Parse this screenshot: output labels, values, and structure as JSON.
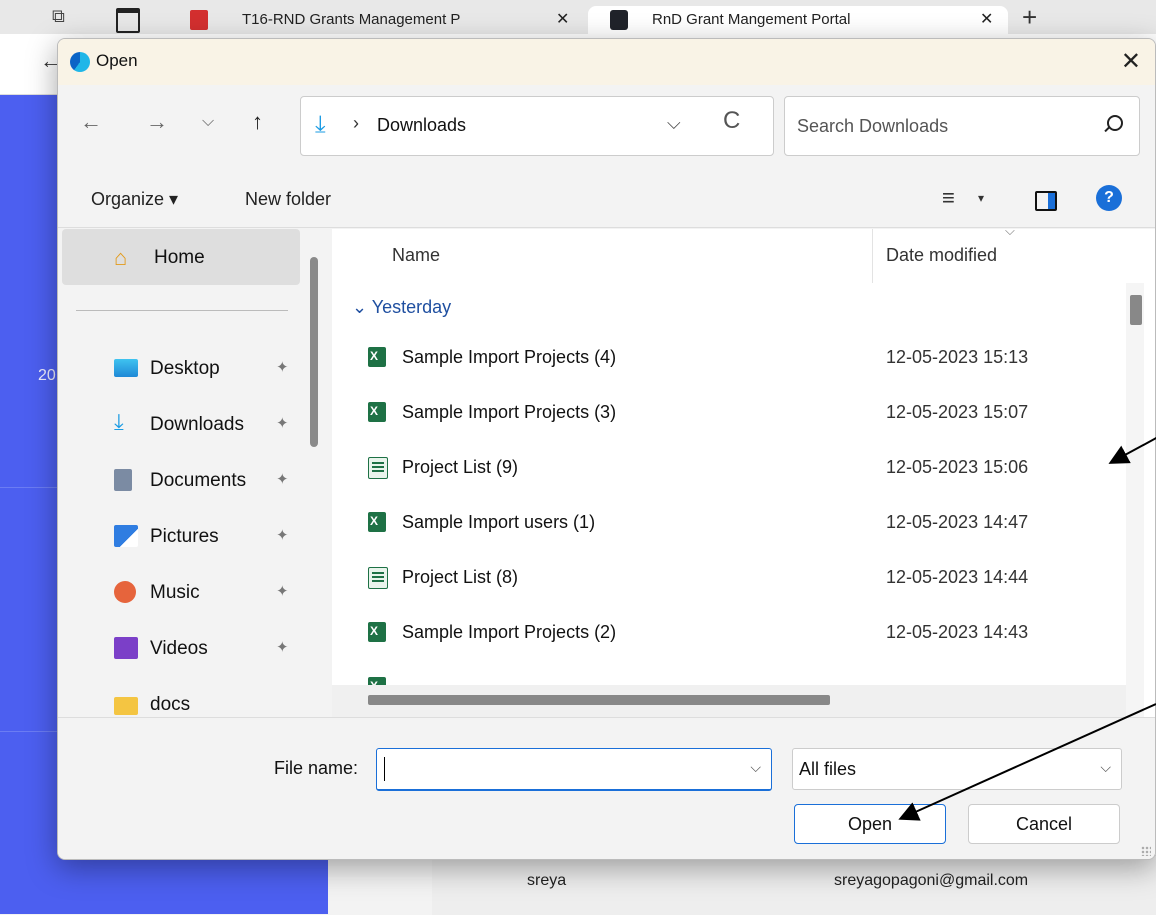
{
  "browser": {
    "tabs": [
      {
        "label": "T16-RND Grants Management P"
      },
      {
        "label": "RnD Grant Mangement Portal"
      }
    ],
    "tab_close": "✕",
    "new_tab": "+",
    "background_text": {
      "left_fragment": "20",
      "table_user_name": "sreya",
      "table_user_email": "sreyagopagoni@gmail.com"
    }
  },
  "dialog": {
    "title": "Open",
    "close_icon": "✕",
    "nav": {
      "back": "←",
      "forward": "→",
      "recent": "⌵",
      "up": "↑"
    },
    "address": {
      "separator": "›",
      "path": "Downloads",
      "dropdown": "⌵",
      "refresh": "C"
    },
    "search": {
      "placeholder": "Search Downloads"
    },
    "commands": {
      "organize": "Organize ▾",
      "new_folder": "New folder",
      "view_icon": "≡",
      "view_dropdown": "▾",
      "help": "?"
    },
    "nav_pane": {
      "home": "Home",
      "items": [
        {
          "label": "Desktop"
        },
        {
          "label": "Downloads"
        },
        {
          "label": "Documents"
        },
        {
          "label": "Pictures"
        },
        {
          "label": "Music"
        },
        {
          "label": "Videos"
        },
        {
          "label": "docs"
        }
      ],
      "pin_glyph": "📌"
    },
    "file_list": {
      "columns": {
        "name": "Name",
        "date": "Date modified"
      },
      "group_label": "Yesterday",
      "group_chevron": "⌄",
      "sort_chevron": "⌵",
      "rows": [
        {
          "name": "Sample Import Projects (4)",
          "date": "12-05-2023 15:13",
          "icon": "excel-icon"
        },
        {
          "name": "Sample Import Projects (3)",
          "date": "12-05-2023 15:07",
          "icon": "excel-icon"
        },
        {
          "name": "Project List (9)",
          "date": "12-05-2023 15:06",
          "icon": "spreadsheet-icon"
        },
        {
          "name": "Sample Import users (1)",
          "date": "12-05-2023 14:47",
          "icon": "excel-icon"
        },
        {
          "name": "Project List (8)",
          "date": "12-05-2023 14:44",
          "icon": "spreadsheet-icon"
        },
        {
          "name": "Sample Import Projects (2)",
          "date": "12-05-2023 14:43",
          "icon": "excel-icon"
        }
      ]
    },
    "bottom": {
      "file_name_label": "File name:",
      "file_name_value": "",
      "file_type": "All files",
      "dropdown": "⌵",
      "open_button": "Open",
      "cancel_button": "Cancel"
    }
  },
  "colors": {
    "accent": "#1a6fd8",
    "bg_sidebar": "#4c5ff0",
    "group_label": "#1f4fa0",
    "excel_green": "#1e7145"
  }
}
